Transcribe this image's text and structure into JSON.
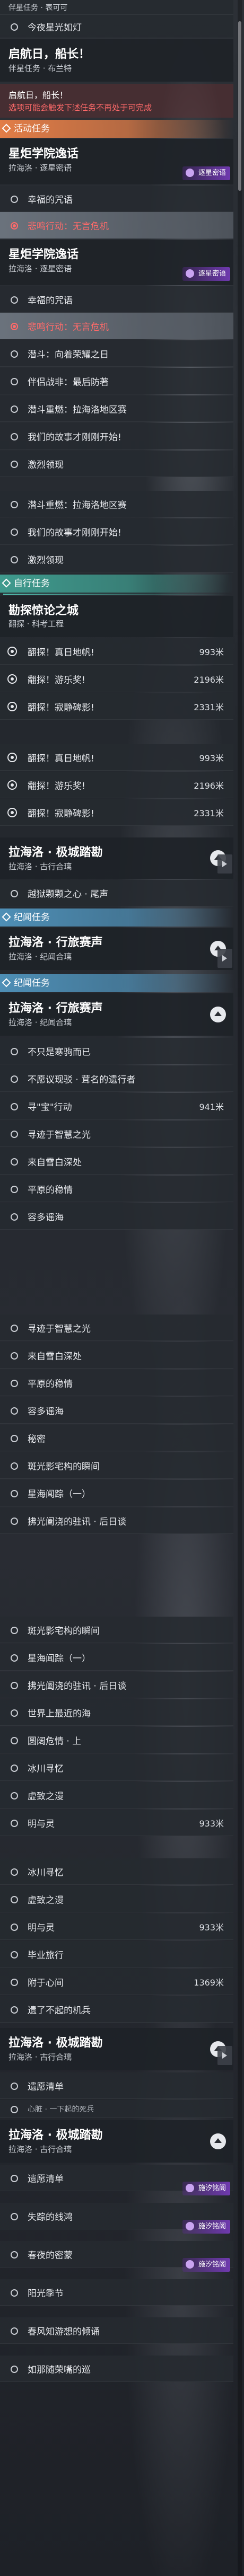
{
  "quests": {
    "top_partial": "伴星任务 · 表可可",
    "top_item": "今夜星光如灯",
    "qiji": {
      "title": "启航日，船长！",
      "sub": "伴星任务 · 布兰特"
    },
    "qiji2": {
      "title": "启航日，船长！",
      "warn": "选项可能会触发下述任务不再处于可完成"
    },
    "activity_header": "活动任务",
    "xtg": {
      "title": "星炬学院逸话",
      "sub": "拉海洛 · 逐星密语",
      "badge": "逐星密语"
    },
    "xtg2": {
      "title": "星炬学院逸话",
      "sub": "拉海洛 · 逐星密语",
      "badge": "逐星密语"
    },
    "xtg_items": [
      "幸福的咒语",
      "悲鸣行动：无言危机"
    ],
    "xtg2_items": [
      "幸福的咒语",
      "悲鸣行动：无言危机"
    ],
    "main_list_1": [
      "潜斗：向着荣耀之日",
      "伴侣战非：最后防著",
      "潜斗重燃：拉海洛地区赛",
      "我们的故事才刚刚开始!",
      "激烈领现",
      "潜斗重燃：拉海洛地区赛",
      "我们的故事才刚刚开始!",
      "激烈领现"
    ],
    "adv_header": "自行任务",
    "ancient": {
      "title": "勘探惊论之城",
      "sub": "翻探 · 科考工程"
    },
    "adv_items": [
      {
        "label": "翻探！真日地帆!",
        "dist": "993米"
      },
      {
        "label": "翻探！游乐奖!",
        "dist": "2196米"
      },
      {
        "label": "翻探！寂静碑影!",
        "dist": "2331米"
      },
      {
        "label": "翻探！真日地帆!",
        "dist": "993米"
      },
      {
        "label": "翻探！游乐奖!",
        "dist": "2196米"
      },
      {
        "label": "翻探！寂静碑影!",
        "dist": "2331米"
      }
    ],
    "laha1": {
      "title": "拉海洛 · 极城踏勘",
      "sub": "拉海洛 · 古行合璃"
    },
    "laha1_items": [
      "越狱颗颗之心 · 尾声"
    ],
    "record_header": "纪闻任务",
    "laha2": {
      "title": "拉海洛 · 行旅赛声",
      "sub": "拉海洛 · 纪闻合璃"
    },
    "record_header2": "纪闻任务",
    "laha3": {
      "title": "拉海洛 · 行旅赛声",
      "sub": "拉海洛 · 纪闻合璃"
    },
    "laha3_items": [
      {
        "label": "不只是寒驹而已",
        "dist": ""
      },
      {
        "label": "不愿议现驳 · 茸名的遗行者",
        "dist": ""
      },
      {
        "label": "寻\"宝\"行动",
        "dist": "941米"
      },
      {
        "label": "寻迹于智慧之光",
        "dist": ""
      },
      {
        "label": "来自雪白深处",
        "dist": ""
      },
      {
        "label": "平原的稳情",
        "dist": ""
      },
      {
        "label": "容多谣海",
        "dist": ""
      },
      {
        "label": "寻迹于智慧之光",
        "dist": ""
      },
      {
        "label": "来自雪白深处",
        "dist": ""
      },
      {
        "label": "平原的稳情",
        "dist": ""
      },
      {
        "label": "容多谣海",
        "dist": ""
      },
      {
        "label": "秘密",
        "dist": ""
      },
      {
        "label": "斑光影宅构的瞬间",
        "dist": ""
      },
      {
        "label": "星海闻踪（一）",
        "dist": ""
      },
      {
        "label": "拂光阖浇的驻讯 · 后日谈",
        "dist": ""
      },
      {
        "label": "斑光影宅构的瞬间",
        "dist": ""
      },
      {
        "label": "星海闻踪（一）",
        "dist": ""
      },
      {
        "label": "拂光阖浇的驻讯 · 后日谈",
        "dist": ""
      },
      {
        "label": "世界上最近的海",
        "dist": ""
      },
      {
        "label": "圆阔危情 · 上",
        "dist": ""
      },
      {
        "label": "冰川寻忆",
        "dist": ""
      },
      {
        "label": "虚致之漫",
        "dist": ""
      },
      {
        "label": "明与灵",
        "dist": "933米"
      },
      {
        "label": "冰川寻忆",
        "dist": ""
      },
      {
        "label": "虚致之漫",
        "dist": ""
      },
      {
        "label": "明与灵",
        "dist": "933米"
      },
      {
        "label": "毕业旅行",
        "dist": ""
      },
      {
        "label": "附于心间",
        "dist": "1369米"
      },
      {
        "label": "遗了不起的机兵",
        "dist": ""
      }
    ],
    "laha4": {
      "title": "拉海洛 · 极城踏勘",
      "sub": "拉海洛 · 古行合璃"
    },
    "laha4_items": [
      "遗愿清单",
      "心脏 · 一下起的死兵"
    ],
    "laha5": {
      "title": "拉海洛 · 极城踏勘",
      "sub": "拉海洛 · 古行合璃"
    },
    "laha5_items": [
      "遗愿清单",
      "失踪的线鸿",
      "春夜的密蒙",
      "阳光季节",
      "春风知游想的倾诵",
      "如那随荣嘴的巡"
    ],
    "float_badge": "施汐铭阁",
    "float_badge2": "施汐铭阁",
    "float_badge3": "施汐铭阁"
  },
  "colors": {
    "orange": "#e27d47",
    "blue": "#4e8fb6",
    "teal": "#3f9b8e",
    "red": "#ff6a6a"
  }
}
